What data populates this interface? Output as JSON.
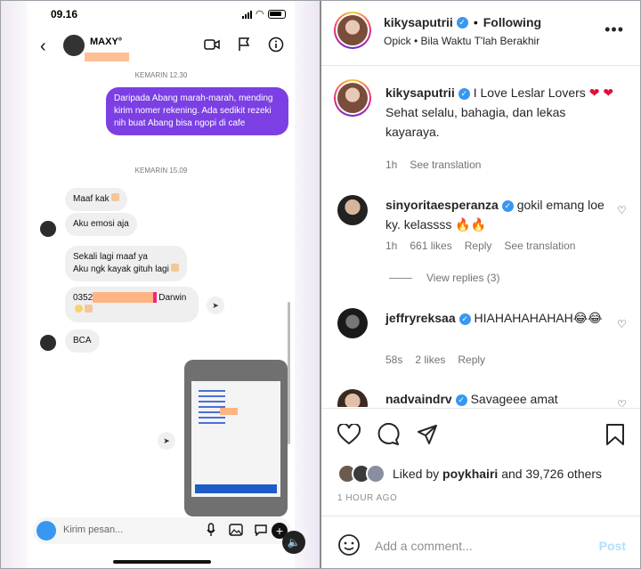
{
  "phone": {
    "time": "09.16",
    "contact_name": "MAXY°",
    "stamp1": "KEMARIN 12.30",
    "stamp2": "KEMARIN 15.09",
    "my_message": "Daripada Abang marah-marah, mending kirim nomer rekening. Ada sedikit rezeki nih buat Abang bisa ngopi di cafe",
    "msg_maaf": "Maaf kak",
    "msg_emosi": "Aku emosi aja",
    "msg_sekali_1": "Sekali lagi maaf ya",
    "msg_sekali_2": "Aku ngk kayak gituh lagi",
    "msg_account_prefix": "0352",
    "msg_account_suffix": "Darwin",
    "msg_bca": "BCA",
    "composer_placeholder": "Kirim pesan...",
    "accent": "#7b3fe4"
  },
  "post": {
    "author": "kikysaputrii",
    "following": "Following",
    "subtitle": "Opick • Bila Waktu T'lah Berakhir",
    "caption_text": "I Love Leslar Lovers",
    "caption_line2": "Sehat selalu, bahagia, dan lekas kayaraya.",
    "caption_time": "1h",
    "see_translation": "See translation",
    "comments": [
      {
        "user": "sinyoritaesperanza",
        "text": "gokil emang loe ky. kelassss 🔥🔥",
        "time": "1h",
        "likes": "661 likes",
        "reply": "Reply",
        "translate": "See translation"
      },
      {
        "user": "jeffryreksaa",
        "text": "HIAHAHAHAHAH😂😂",
        "time": "58s",
        "likes": "2 likes",
        "reply": "Reply"
      },
      {
        "user": "nadvaindrv",
        "text": "Savageee amat"
      }
    ],
    "view_replies": "View replies (3)",
    "liked_by_prefix": "Liked by",
    "liked_by_user": "poykhairi",
    "liked_by_suffix": "and 39,726 others",
    "posted_ago": "1 HOUR AGO",
    "add_comment_placeholder": "Add a comment...",
    "post_label": "Post",
    "verified_color": "#3897f0",
    "icons": [
      "heart-icon",
      "comment-icon",
      "send-icon",
      "bookmark-icon",
      "emoji-icon",
      "more-icon"
    ]
  }
}
